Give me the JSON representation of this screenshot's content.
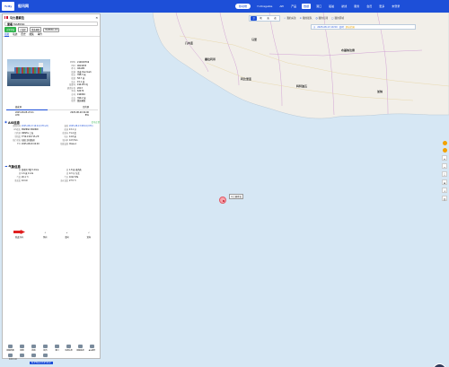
{
  "topbar": {
    "logo": "Ycity",
    "brand": "船讯网"
  },
  "nav": {
    "items": [
      "船舶搜索",
      "Yi-Dragable",
      "API",
      "产品",
      "数据",
      "港口",
      "船舶",
      "航线",
      "服务",
      "会员",
      "服务",
      "更多"
    ],
    "pill": "移动端",
    "user": "未登录"
  },
  "maptool": {
    "segs": [
      "卫",
      "地",
      "海",
      "夜"
    ],
    "buttons": [
      "我的关注",
      "我的船队",
      "我的订阅",
      "我的区域"
    ]
  },
  "timebar": {
    "label": "2025-08-13 16:50",
    "knots": "实时",
    "yellow": "超出范围"
  },
  "panel": {
    "title": "马士基索拉",
    "search_label": "查看",
    "search_value": "MAERSK",
    "tags": [
      "正常状态",
      "已锁定",
      "集装箱船",
      "MAERSK A/S"
    ],
    "tabs": [
      "船舶",
      "轨迹",
      "历史",
      "图集",
      "事件"
    ],
    "specs": [
      {
        "label": "MMSI",
        "value": "219018769"
      },
      {
        "label": "IMO",
        "value": "9619933"
      },
      {
        "label": "呼号",
        "value": "OXAM2"
      },
      {
        "label": "船旗",
        "value": "丹麦 Denmark"
      },
      {
        "label": "船长",
        "value": "398.3 米"
      },
      {
        "label": "船宽",
        "value": "58.7 米"
      },
      {
        "label": "吃水",
        "value": "15.1 米"
      },
      {
        "label": "载重吨",
        "value": "194153 吨"
      },
      {
        "label": "建造年份",
        "value": "2013"
      },
      {
        "label": "净吨",
        "value": "62474"
      },
      {
        "label": "总吨",
        "value": "194849"
      },
      {
        "label": "总长",
        "value": "399.2 米"
      },
      {
        "label": "船型",
        "value": "集装箱船"
      }
    ],
    "ports": {
      "from": "始发港",
      "to": "目的港",
      "from_time": "2025-08-08 23:21",
      "to_time": "2025-08-20 04:00",
      "from_name": "ATD",
      "to_name": "ETA",
      "progress": 0.45
    },
    "ais": {
      "title": "AIS信息",
      "status": "信号正常",
      "rows": [
        [
          {
            "label": "更新时间",
            "value": "2025-08-13 16:44 (UTC+8)",
            "blue": true
          },
          {
            "label": "接收",
            "value": "2025-08-13 08:44 (UTC)",
            "blue": true
          }
        ],
        [
          {
            "label": "AIS船名",
            "value": "MAERSK MADRID"
          },
          {
            "label": "航速",
            "value": "13.1 节"
          }
        ],
        [
          {
            "label": "目的港",
            "value": "CNSHG 上海"
          },
          {
            "label": "航首向",
            "value": "71.2 度"
          }
        ],
        [
          {
            "label": "经纬度",
            "value": "3°59.4′N  6°15.2′E"
          },
          {
            "label": "吃水",
            "value": "14.8 米"
          }
        ],
        [
          {
            "label": "航行状态",
            "value": "在航(主机推动)"
          },
          {
            "label": "转向率",
            "value": "0.0°/min"
          }
        ],
        [
          {
            "label": "ETA",
            "value": "2025-08-20 04:00"
          },
          {
            "label": "船载设备",
            "value": "Class A"
          }
        ]
      ]
    },
    "weather": {
      "title": "气象信息",
      "rows": [
        [
          {
            "label": "风",
            "value": "西南风 3级 5.2m/s"
          },
          {
            "label": "浪",
            "value": "1.8 米 南西南"
          }
        ],
        [
          {
            "label": "涌",
            "value": "1.6 米 11.2s"
          },
          {
            "label": "流",
            "value": "0.3 节 东北"
          }
        ],
        [
          {
            "label": "气温",
            "value": "26.1 ℃"
          },
          {
            "label": "气压",
            "value": "1012 hPa"
          }
        ],
        [
          {
            "label": "能见度",
            "value": "10 km"
          },
          {
            "label": "海水温度",
            "value": "27.5 ℃"
          }
        ]
      ],
      "icons": [
        "航迹方向",
        "风向",
        "浪向",
        "流向"
      ]
    },
    "tools": [
      "船舶档案",
      "船期",
      "航线",
      "船员",
      "港口",
      "动态信息",
      "船舶监控",
      "AIS报告",
      "历史轨迹",
      "附近船舶",
      "气象",
      "更多"
    ]
  },
  "map": {
    "vessel_label": "马士基索拉",
    "countries": [
      "几内亚",
      "塞拉利昂",
      "利比里亚",
      "科特迪瓦",
      "加纳",
      "布基纳法索",
      "马里"
    ],
    "scale": "100 km",
    "coords": "N 3°59.4′  E 6°15.2′"
  },
  "colors": {
    "brand": "#1d4fd8",
    "sea": "#d6e7f4",
    "land": "#f2efe9",
    "marker": "#e05a66"
  }
}
